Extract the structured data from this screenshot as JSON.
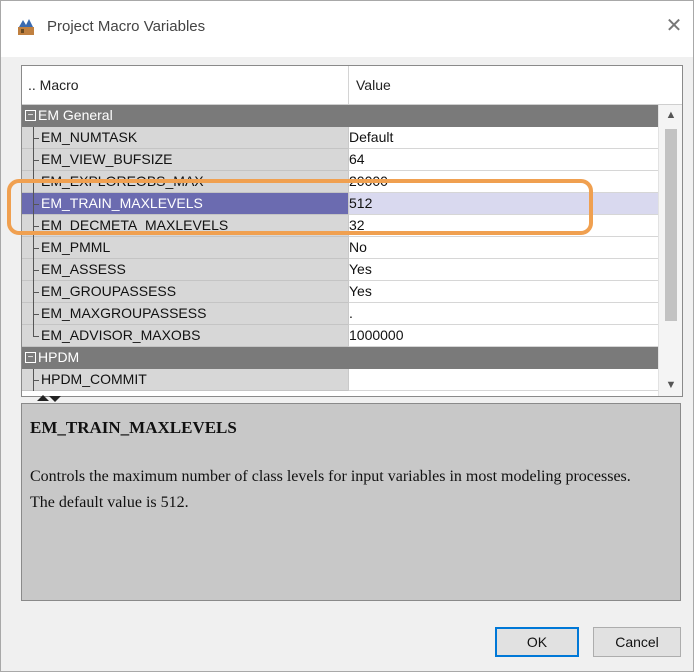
{
  "window": {
    "title": "Project Macro Variables",
    "close_icon": "close-x-icon",
    "app_icon": "sas-miner-icon"
  },
  "grid": {
    "columns": {
      "macro": ".. Macro",
      "value": "Value"
    },
    "groups": [
      {
        "label": "EM General",
        "toggle": "−",
        "items": [
          {
            "name": "EM_NUMTASK",
            "value": "Default"
          },
          {
            "name": "EM_VIEW_BUFSIZE",
            "value": "64"
          },
          {
            "name": "EM_EXPLOREOBS_MAX",
            "value": "20000"
          },
          {
            "name": "EM_TRAIN_MAXLEVELS",
            "value": "512",
            "selected": true
          },
          {
            "name": "EM_DECMETA_MAXLEVELS",
            "value": "32"
          },
          {
            "name": "EM_PMML",
            "value": "No"
          },
          {
            "name": "EM_ASSESS",
            "value": "Yes"
          },
          {
            "name": "EM_GROUPASSESS",
            "value": "Yes"
          },
          {
            "name": "EM_MAXGROUPASSESS",
            "value": "."
          },
          {
            "name": "EM_ADVISOR_MAXOBS",
            "value": "1000000"
          }
        ]
      },
      {
        "label": "HPDM",
        "toggle": "−",
        "items": [
          {
            "name": "HPDM_COMMIT",
            "value": ""
          }
        ]
      }
    ],
    "scroll": {
      "up": "▲",
      "down": "▼"
    }
  },
  "description": {
    "title": "EM_TRAIN_MAXLEVELS",
    "body": "Controls the maximum number of class levels for input variables in most modeling processes. The default value is 512."
  },
  "buttons": {
    "ok": "OK",
    "cancel": "Cancel"
  },
  "colors": {
    "group_header": "#7a7a7a",
    "selected_name": "#6b6bb0",
    "selected_value": "#d9d9ef",
    "highlight": "#f0a050",
    "desc_panel": "#c8c8c8"
  }
}
